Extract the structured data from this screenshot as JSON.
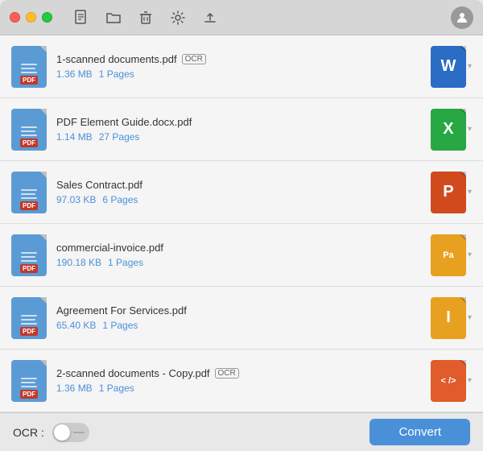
{
  "titlebar": {
    "buttons": [
      "close",
      "minimize",
      "maximize"
    ],
    "icons": [
      "new-file",
      "open-folder",
      "trash",
      "settings",
      "upload",
      "account"
    ]
  },
  "files": [
    {
      "id": 1,
      "name": "1-scanned documents.pdf",
      "ocr": true,
      "size": "1.36 MB",
      "pages": "1 Pages",
      "output_type": "word",
      "output_letter": "W"
    },
    {
      "id": 2,
      "name": "PDF Element Guide.docx.pdf",
      "ocr": false,
      "size": "1.14 MB",
      "pages": "27 Pages",
      "output_type": "excel",
      "output_letter": "X"
    },
    {
      "id": 3,
      "name": "Sales Contract.pdf",
      "ocr": false,
      "size": "97.03 KB",
      "pages": "6 Pages",
      "output_type": "ppt",
      "output_letter": "P"
    },
    {
      "id": 4,
      "name": "commercial-invoice.pdf",
      "ocr": false,
      "size": "190.18 KB",
      "pages": "1 Pages",
      "output_type": "pa",
      "output_letter": "Pa"
    },
    {
      "id": 5,
      "name": "Agreement For Services.pdf",
      "ocr": false,
      "size": "65.40 KB",
      "pages": "1 Pages",
      "output_type": "indd",
      "output_letter": "I"
    },
    {
      "id": 6,
      "name": "2-scanned documents - Copy.pdf",
      "ocr": true,
      "size": "1.36 MB",
      "pages": "1 Pages",
      "output_type": "code",
      "output_letter": "< />"
    }
  ],
  "bottom": {
    "ocr_label": "OCR :",
    "convert_label": "Convert"
  }
}
